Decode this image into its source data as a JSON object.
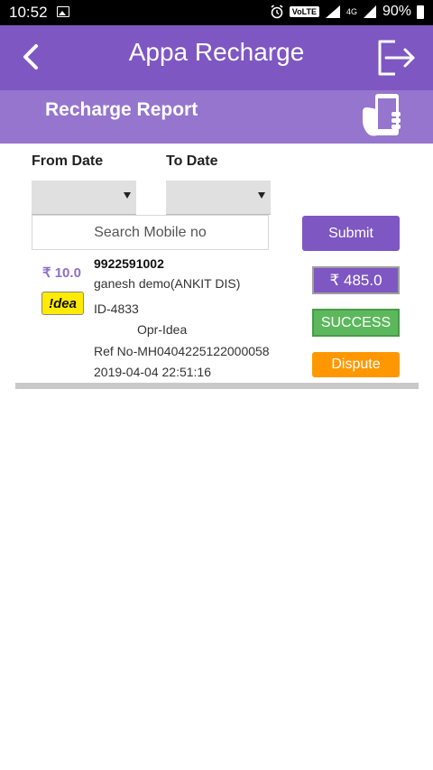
{
  "status_bar": {
    "time": "10:52",
    "network": "VoLTE",
    "network_type": "4G",
    "battery": "90%"
  },
  "app_bar": {
    "title": "Appa Recharge"
  },
  "sub_header": {
    "title": "Recharge Report"
  },
  "filters": {
    "from_date_label": "From Date",
    "to_date_label": "To Date",
    "from_date_value": "",
    "to_date_value": "",
    "search_placeholder": "Search Mobile no",
    "submit_label": "Submit"
  },
  "record": {
    "amount": "₹ 10.0",
    "operator_logo_text": "!dea",
    "mobile": "9922591002",
    "name": "ganesh demo(ANKIT DIS)",
    "id": "ID-4833",
    "operator": "Opr-Idea",
    "ref": "Ref No-MH0404225122000058",
    "datetime": "2019-04-04 22:51:16",
    "balance": "₹ 485.0",
    "status": "SUCCESS",
    "dispute_label": "Dispute"
  },
  "colors": {
    "primary": "#7e57c2",
    "secondary": "#9575cd",
    "success": "#5cb85c",
    "dispute": "#ff9800"
  }
}
